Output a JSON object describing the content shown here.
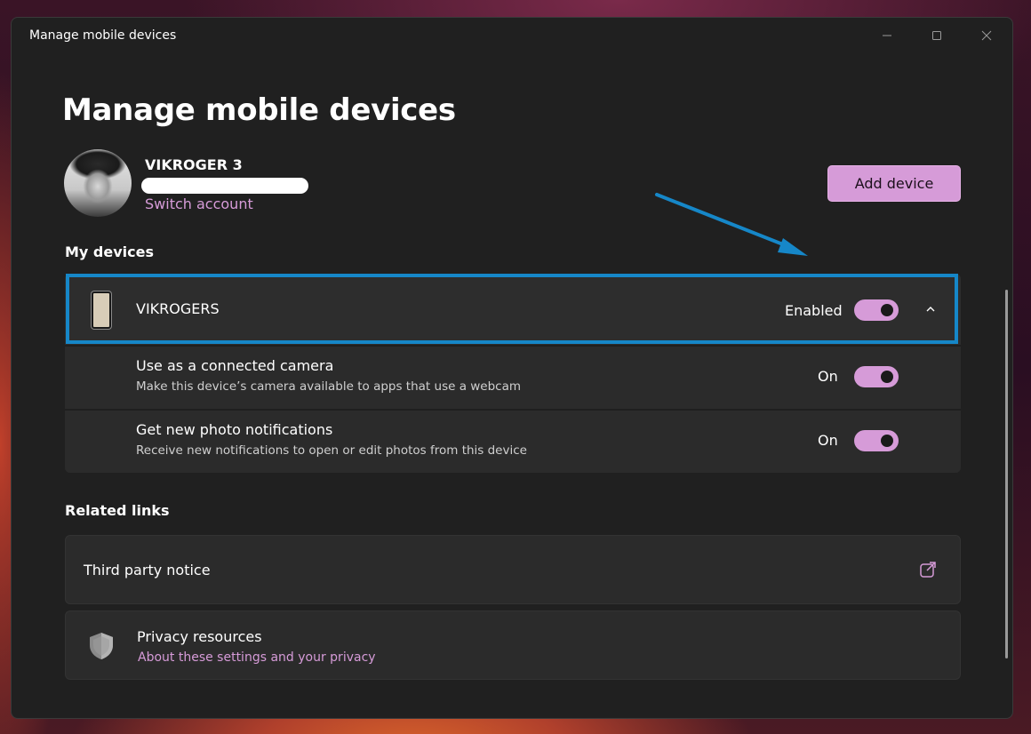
{
  "window": {
    "title": "Manage mobile devices",
    "controls": [
      "minimize-icon",
      "maximize-icon",
      "close-icon"
    ]
  },
  "page": {
    "title": "Manage mobile devices"
  },
  "account": {
    "name": "VIKROGER 3",
    "switch_label": "Switch account",
    "add_device_label": "Add device"
  },
  "my_devices": {
    "title": "My devices",
    "device": {
      "name": "VIKROGERS",
      "status": "Enabled",
      "enabled": true,
      "icon": "phone-icon"
    },
    "settings": [
      {
        "title": "Use as a connected camera",
        "description": "Make this device’s camera available to apps that use a webcam",
        "state": "On"
      },
      {
        "title": "Get new photo notifications",
        "description": "Receive new notifications to open or edit photos from this device",
        "state": "On"
      }
    ]
  },
  "related_links": {
    "title": "Related links",
    "third_party": {
      "label": "Third party notice",
      "icon": "external-link-icon"
    },
    "privacy": {
      "title": "Privacy resources",
      "link": "About these settings and your privacy",
      "icon": "shield-icon"
    }
  },
  "colors": {
    "accent": "#d69bd8",
    "highlight_border": "#1687c8",
    "window_bg": "#202020",
    "card_bg": "#2b2b2b"
  }
}
